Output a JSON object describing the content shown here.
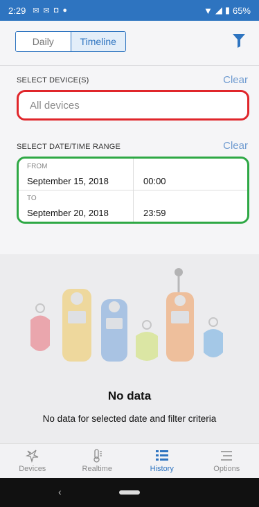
{
  "status_bar": {
    "time": "2:29",
    "notification_icons": [
      "notification-icon",
      "notification-icon",
      "notification-icon",
      "notification-icon"
    ],
    "battery": "65%"
  },
  "view_toggle": {
    "daily_label": "Daily",
    "timeline_label": "Timeline",
    "selected": "Timeline"
  },
  "device_section": {
    "label": "SELECT DEVICE(S)",
    "clear_label": "Clear",
    "value": "All devices"
  },
  "date_section": {
    "label": "SELECT DATE/TIME RANGE",
    "clear_label": "Clear",
    "from": {
      "label": "FROM",
      "date": "September 15, 2018",
      "time": "00:00"
    },
    "to": {
      "label": "TO",
      "date": "September 20, 2018",
      "time": "23:59"
    }
  },
  "empty_state": {
    "title": "No data",
    "message": "No data for selected date and filter criteria"
  },
  "bottom_nav": {
    "items": [
      {
        "label": "Devices",
        "icon": "devices-icon"
      },
      {
        "label": "Realtime",
        "icon": "thermometer-icon"
      },
      {
        "label": "History",
        "icon": "history-list-icon",
        "active": true
      },
      {
        "label": "Options",
        "icon": "options-menu-icon"
      }
    ]
  },
  "colors": {
    "accent": "#2e74c0",
    "device_highlight": "#e0262b",
    "date_highlight": "#2ea845"
  }
}
